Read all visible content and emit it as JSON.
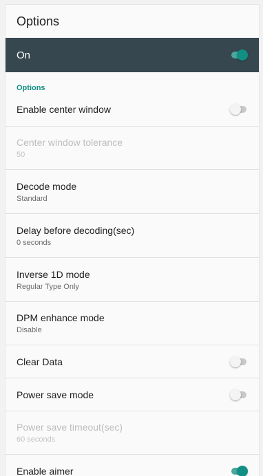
{
  "toolbar": {
    "title": "Options"
  },
  "master": {
    "label": "On",
    "enabled": true
  },
  "section": {
    "header": "Options"
  },
  "items": [
    {
      "title": "Enable center window",
      "toggle": false
    },
    {
      "title": "Center window tolerance",
      "summary": "50",
      "disabled": true
    },
    {
      "title": "Decode mode",
      "summary": "Standard"
    },
    {
      "title": "Delay before decoding(sec)",
      "summary": "0 seconds"
    },
    {
      "title": "Inverse 1D mode",
      "summary": "Regular Type Only"
    },
    {
      "title": "DPM enhance mode",
      "summary": "Disable"
    },
    {
      "title": "Clear Data",
      "toggle": false
    },
    {
      "title": "Power save mode",
      "toggle": false
    },
    {
      "title": "Power save timeout(sec)",
      "summary": "60 seconds",
      "disabled": true
    },
    {
      "title": "Enable aimer",
      "toggle": true
    }
  ],
  "colors": {
    "accent": "#128f84",
    "master_bar": "#36474f",
    "disabled_text": "#bdbdbd"
  }
}
